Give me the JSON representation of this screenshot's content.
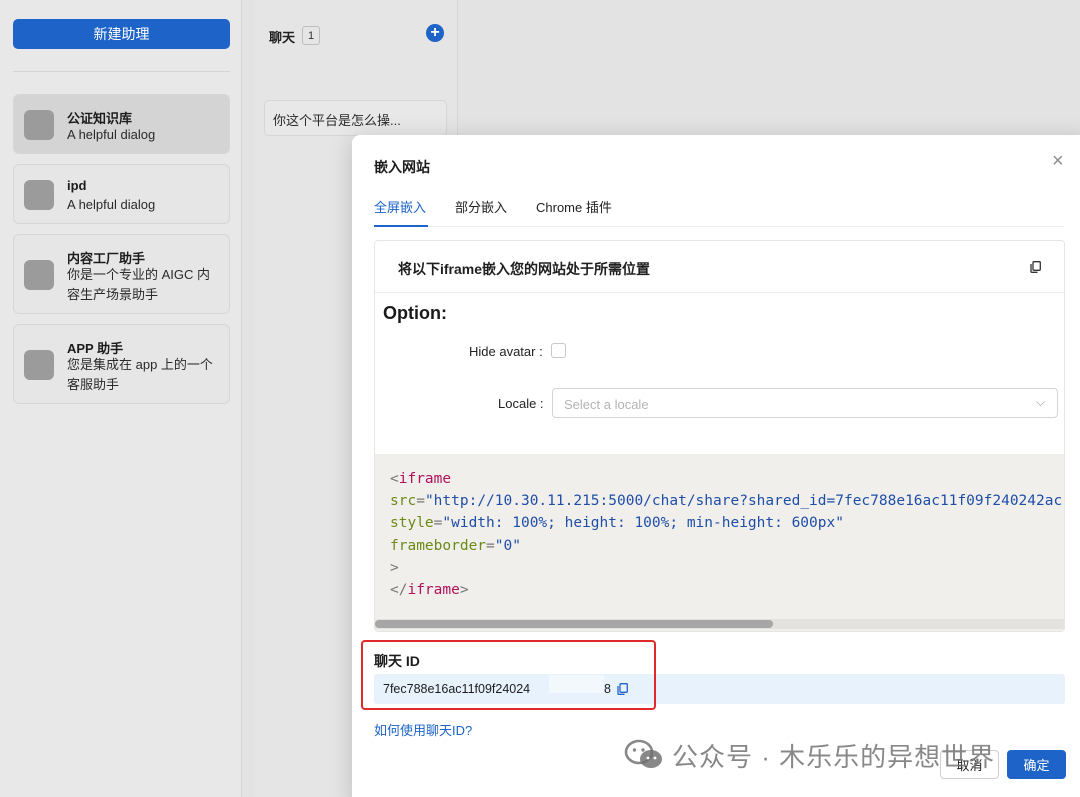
{
  "sidebar": {
    "new_button": "新建助理",
    "assistants": [
      {
        "name": "公证知识库",
        "desc_lines": [
          "A helpful dialog"
        ]
      },
      {
        "name": "ipd",
        "desc_lines": [
          "A helpful dialog"
        ]
      },
      {
        "name": "内容工厂助手",
        "desc_lines": [
          "你是一个专业的 AIGC 内",
          "容生产场景助手"
        ]
      },
      {
        "name": "APP 助手",
        "desc_lines": [
          "您是集成在 app 上的一个",
          "客服助手"
        ]
      }
    ]
  },
  "chat": {
    "title": "聊天",
    "count": "1",
    "items": [
      "你这个平台是怎么操..."
    ]
  },
  "modal": {
    "title": "嵌入网站",
    "close": "×",
    "tabs": [
      "全屏嵌入",
      "部分嵌入",
      "Chrome 插件"
    ],
    "card_title": "将以下iframe嵌入您的网站处于所需位置",
    "option_title": "Option:",
    "hide_avatar_label": "Hide avatar",
    "locale_label": "Locale",
    "locale_placeholder": "Select a locale",
    "code": {
      "open_tag": "iframe",
      "src_attr": "src",
      "src_value": "\"http://10.30.11.215:5000/chat/share?shared_id=7fec788e16ac11f09f240242ac",
      "style_attr": "style",
      "style_value": "\"width: 100%; height: 100%; min-height: 600px\"",
      "frameborder_attr": "frameborder",
      "frameborder_value": "\"0\"",
      "close_tag": "iframe"
    },
    "chat_id_label": "聊天 ID",
    "chat_id_value": "7fec788e16ac11f09f24024",
    "chat_id_tail": "8",
    "help_link": "如何使用聊天ID?",
    "cancel_button": "取消",
    "ok_button": "确定"
  },
  "watermark": "公众号 · 木乐乐的异想世界",
  "colors": {
    "primary": "#1d63c8",
    "highlight_border": "#e02a2a",
    "chat_id_bg": "#e8f2fc"
  }
}
